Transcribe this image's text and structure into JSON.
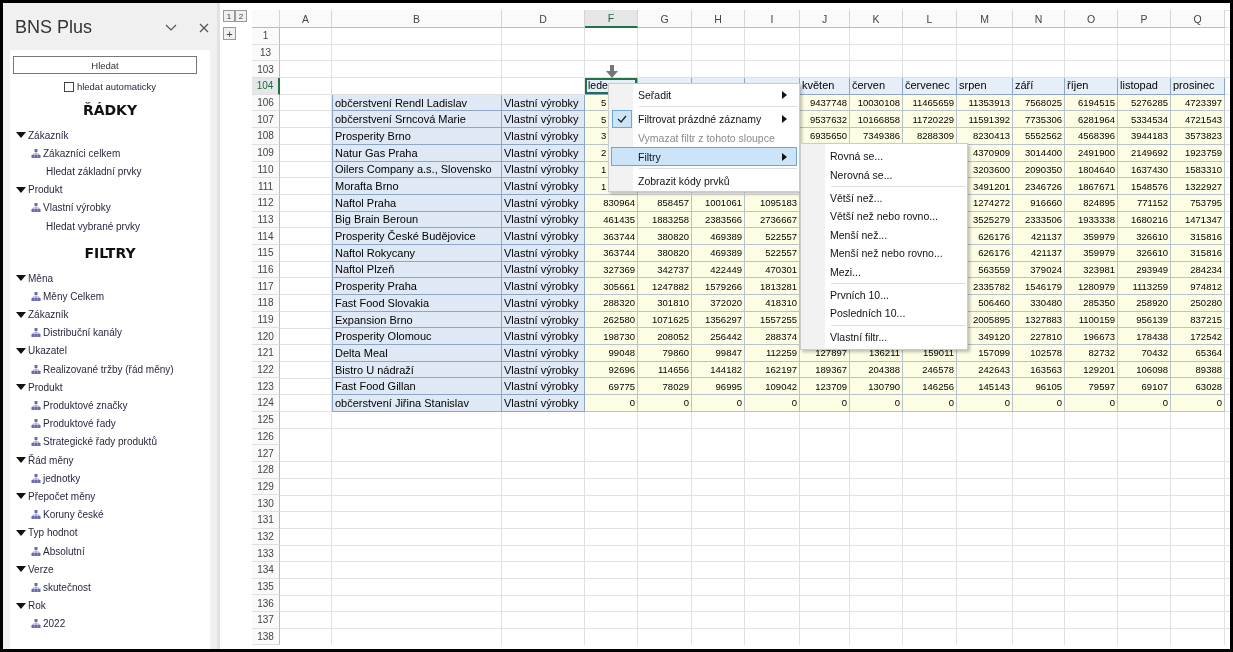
{
  "sidebar": {
    "title": "BNS Plus",
    "search_button": "Hledat",
    "auto_search": {
      "label": "hledat automaticky",
      "checked": false
    },
    "sections": [
      {
        "heading": "ŘÁDKY",
        "groups": [
          {
            "label": "Zákazník",
            "expanded": true,
            "children": [
              {
                "label": "Zákazníci celkem",
                "kind": "member"
              },
              {
                "label": "Hledat základní prvky",
                "kind": "link"
              }
            ]
          },
          {
            "label": "Produkt",
            "expanded": true,
            "children": [
              {
                "label": "Vlastní výrobky",
                "kind": "member"
              },
              {
                "label": "Hledat vybrané prvky",
                "kind": "link"
              }
            ]
          }
        ]
      },
      {
        "heading": "FILTRY",
        "groups": [
          {
            "label": "Měna",
            "expanded": true,
            "children": [
              {
                "label": "Měny Celkem",
                "kind": "member"
              }
            ]
          },
          {
            "label": "Zákazník",
            "expanded": true,
            "children": [
              {
                "label": "Distribuční kanály",
                "kind": "member"
              }
            ]
          },
          {
            "label": "Ukazatel",
            "expanded": true,
            "children": [
              {
                "label": "Realizované tržby (řád měny)",
                "kind": "member"
              }
            ]
          },
          {
            "label": "Produkt",
            "expanded": true,
            "children": [
              {
                "label": "Produktové značky",
                "kind": "member"
              },
              {
                "label": "Produktové řady",
                "kind": "member"
              },
              {
                "label": "Strategické řady produktů",
                "kind": "member"
              }
            ]
          },
          {
            "label": "Řád měny",
            "expanded": true,
            "children": [
              {
                "label": "jednotky",
                "kind": "member"
              }
            ]
          },
          {
            "label": "Přepočet měny",
            "expanded": true,
            "children": [
              {
                "label": "Koruny české",
                "kind": "member"
              }
            ]
          },
          {
            "label": "Typ hodnot",
            "expanded": true,
            "children": [
              {
                "label": "Absolutní",
                "kind": "member"
              }
            ]
          },
          {
            "label": "Verze",
            "expanded": true,
            "children": [
              {
                "label": "skutečnost",
                "kind": "member"
              }
            ]
          },
          {
            "label": "Rok",
            "expanded": true,
            "children": [
              {
                "label": "2022",
                "kind": "member"
              }
            ]
          }
        ]
      }
    ]
  },
  "sheet": {
    "outline": {
      "levels": [
        "1",
        "2"
      ],
      "expand": "+"
    },
    "columns": [
      {
        "label": "A",
        "selected": false
      },
      {
        "label": "B",
        "selected": false
      },
      {
        "label": "D",
        "selected": false
      },
      {
        "label": "F",
        "selected": true
      },
      {
        "label": "G",
        "selected": false
      },
      {
        "label": "H",
        "selected": false
      },
      {
        "label": "I",
        "selected": false
      },
      {
        "label": "J",
        "selected": false
      },
      {
        "label": "K",
        "selected": false
      },
      {
        "label": "L",
        "selected": false
      },
      {
        "label": "M",
        "selected": false
      },
      {
        "label": "N",
        "selected": false
      },
      {
        "label": "O",
        "selected": false
      },
      {
        "label": "P",
        "selected": false
      },
      {
        "label": "Q",
        "selected": false
      }
    ],
    "rows": [
      {
        "number": "1",
        "kind": "blank",
        "selected": false
      },
      {
        "number": "13",
        "kind": "blank",
        "selected": false
      },
      {
        "number": "103",
        "kind": "blank",
        "selected": false
      },
      {
        "number": "104",
        "kind": "header",
        "selected": true,
        "months": [
          {
            "kind": "label",
            "label": "lede",
            "selected": true
          },
          {
            "kind": "covered",
            "selected": false
          },
          {
            "kind": "covered",
            "selected": false
          },
          {
            "kind": "covered",
            "selected": false
          },
          {
            "kind": "label",
            "label": "květen",
            "selected": false
          },
          {
            "kind": "label",
            "label": "červen",
            "selected": false
          },
          {
            "kind": "label",
            "label": "červenec",
            "selected": false
          },
          {
            "kind": "label",
            "label": "srpen",
            "selected": false
          },
          {
            "kind": "label",
            "label": "září",
            "selected": false
          },
          {
            "kind": "label",
            "label": "říjen",
            "selected": false
          },
          {
            "kind": "label",
            "label": "listopad",
            "selected": false
          },
          {
            "kind": "label",
            "label": "prosinec",
            "selected": false
          }
        ]
      },
      {
        "number": "106",
        "kind": "data",
        "selected": false,
        "customer": "občerstvení Rendl Ladislav",
        "product": "Vlastní výrobky",
        "cells": [
          {
            "kind": "clipped",
            "value": "5"
          },
          {
            "kind": "covered"
          },
          {
            "kind": "covered"
          },
          {
            "kind": "covered"
          },
          {
            "kind": "number",
            "value": "9437748"
          },
          {
            "kind": "number",
            "value": "10030108"
          },
          {
            "kind": "number",
            "value": "11465659"
          },
          {
            "kind": "number",
            "value": "11353913"
          },
          {
            "kind": "number",
            "value": "7568025"
          },
          {
            "kind": "number",
            "value": "6194515"
          },
          {
            "kind": "number",
            "value": "5276285"
          },
          {
            "kind": "number",
            "value": "4723397"
          }
        ]
      },
      {
        "number": "107",
        "kind": "data",
        "selected": false,
        "customer": "občerstvení Srncová Marie",
        "product": "Vlastní výrobky",
        "cells": [
          {
            "kind": "clipped",
            "value": "5"
          },
          {
            "kind": "covered"
          },
          {
            "kind": "covered"
          },
          {
            "kind": "covered"
          },
          {
            "kind": "number",
            "value": "9537632"
          },
          {
            "kind": "number",
            "value": "10166858"
          },
          {
            "kind": "number",
            "value": "11720229"
          },
          {
            "kind": "number",
            "value": "11591392"
          },
          {
            "kind": "number",
            "value": "7735306"
          },
          {
            "kind": "number",
            "value": "6281964"
          },
          {
            "kind": "number",
            "value": "5334534"
          },
          {
            "kind": "number",
            "value": "4721543"
          }
        ]
      },
      {
        "number": "108",
        "kind": "data",
        "selected": false,
        "customer": "Prosperity Brno",
        "product": "Vlastní výrobky",
        "cells": [
          {
            "kind": "clipped",
            "value": "3"
          },
          {
            "kind": "covered"
          },
          {
            "kind": "covered"
          },
          {
            "kind": "covered"
          },
          {
            "kind": "number",
            "value": "6935650"
          },
          {
            "kind": "number",
            "value": "7349386"
          },
          {
            "kind": "number",
            "value": "8288309"
          },
          {
            "kind": "number",
            "value": "8230413"
          },
          {
            "kind": "number",
            "value": "5552562"
          },
          {
            "kind": "number",
            "value": "4568396"
          },
          {
            "kind": "number",
            "value": "3944183"
          },
          {
            "kind": "number",
            "value": "3573823"
          }
        ]
      },
      {
        "number": "109",
        "kind": "data",
        "selected": false,
        "customer": "Natur Gas Praha",
        "product": "Vlastní výrobky",
        "cells": [
          {
            "kind": "clipped",
            "value": "2"
          },
          {
            "kind": "covered"
          },
          {
            "kind": "covered"
          },
          {
            "kind": "covered"
          },
          {
            "kind": "covered"
          },
          {
            "kind": "covered"
          },
          {
            "kind": "covered"
          },
          {
            "kind": "number",
            "value": "4370909"
          },
          {
            "kind": "number",
            "value": "3014400"
          },
          {
            "kind": "number",
            "value": "2491900"
          },
          {
            "kind": "number",
            "value": "2149692"
          },
          {
            "kind": "number",
            "value": "1923759"
          }
        ]
      },
      {
        "number": "110",
        "kind": "data",
        "selected": false,
        "customer": "Oilers Company a.s., Slovensko",
        "product": "Vlastní výrobky",
        "cells": [
          {
            "kind": "clipped",
            "value": "1"
          },
          {
            "kind": "covered"
          },
          {
            "kind": "covered"
          },
          {
            "kind": "covered"
          },
          {
            "kind": "covered"
          },
          {
            "kind": "covered"
          },
          {
            "kind": "covered"
          },
          {
            "kind": "number",
            "value": "3203600"
          },
          {
            "kind": "number",
            "value": "2090350"
          },
          {
            "kind": "number",
            "value": "1804640"
          },
          {
            "kind": "number",
            "value": "1637430"
          },
          {
            "kind": "number",
            "value": "1583310"
          }
        ]
      },
      {
        "number": "111",
        "kind": "data",
        "selected": false,
        "customer": "Morafta Brno",
        "product": "Vlastní výrobky",
        "cells": [
          {
            "kind": "clipped",
            "value": "1"
          },
          {
            "kind": "covered"
          },
          {
            "kind": "covered"
          },
          {
            "kind": "covered"
          },
          {
            "kind": "covered"
          },
          {
            "kind": "covered"
          },
          {
            "kind": "covered"
          },
          {
            "kind": "number",
            "value": "3491201"
          },
          {
            "kind": "number",
            "value": "2346726"
          },
          {
            "kind": "number",
            "value": "1867671"
          },
          {
            "kind": "number",
            "value": "1548576"
          },
          {
            "kind": "number",
            "value": "1322927"
          }
        ]
      },
      {
        "number": "112",
        "kind": "data",
        "selected": false,
        "customer": "Naftol Praha",
        "product": "Vlastní výrobky",
        "cells": [
          {
            "kind": "number",
            "value": "830964"
          },
          {
            "kind": "number",
            "value": "858457"
          },
          {
            "kind": "number",
            "value": "1001061"
          },
          {
            "kind": "number",
            "value": "1095183"
          },
          {
            "kind": "covered"
          },
          {
            "kind": "covered"
          },
          {
            "kind": "covered"
          },
          {
            "kind": "number",
            "value": "1274272"
          },
          {
            "kind": "number",
            "value": "916660"
          },
          {
            "kind": "number",
            "value": "824895"
          },
          {
            "kind": "number",
            "value": "771152"
          },
          {
            "kind": "number",
            "value": "753795"
          }
        ]
      },
      {
        "number": "113",
        "kind": "data",
        "selected": false,
        "customer": "Big Brain Beroun",
        "product": "Vlastní výrobky",
        "cells": [
          {
            "kind": "number",
            "value": "461435"
          },
          {
            "kind": "number",
            "value": "1883258"
          },
          {
            "kind": "number",
            "value": "2383566"
          },
          {
            "kind": "number",
            "value": "2736667"
          },
          {
            "kind": "covered"
          },
          {
            "kind": "covered"
          },
          {
            "kind": "covered"
          },
          {
            "kind": "number",
            "value": "3525279"
          },
          {
            "kind": "number",
            "value": "2333506"
          },
          {
            "kind": "number",
            "value": "1933338"
          },
          {
            "kind": "number",
            "value": "1680216"
          },
          {
            "kind": "number",
            "value": "1471347"
          }
        ]
      },
      {
        "number": "114",
        "kind": "data",
        "selected": false,
        "customer": "Prosperity České Budějovice",
        "product": "Vlastní výrobky",
        "cells": [
          {
            "kind": "number",
            "value": "363744"
          },
          {
            "kind": "number",
            "value": "380820"
          },
          {
            "kind": "number",
            "value": "469389"
          },
          {
            "kind": "number",
            "value": "522557"
          },
          {
            "kind": "covered"
          },
          {
            "kind": "covered"
          },
          {
            "kind": "covered"
          },
          {
            "kind": "number",
            "value": "626176"
          },
          {
            "kind": "number",
            "value": "421137"
          },
          {
            "kind": "number",
            "value": "359979"
          },
          {
            "kind": "number",
            "value": "326610"
          },
          {
            "kind": "number",
            "value": "315816"
          }
        ]
      },
      {
        "number": "115",
        "kind": "data",
        "selected": false,
        "customer": "Naftol Rokycany",
        "product": "Vlastní výrobky",
        "cells": [
          {
            "kind": "number",
            "value": "363744"
          },
          {
            "kind": "number",
            "value": "380820"
          },
          {
            "kind": "number",
            "value": "469389"
          },
          {
            "kind": "number",
            "value": "522557"
          },
          {
            "kind": "covered"
          },
          {
            "kind": "covered"
          },
          {
            "kind": "covered"
          },
          {
            "kind": "number",
            "value": "626176"
          },
          {
            "kind": "number",
            "value": "421137"
          },
          {
            "kind": "number",
            "value": "359979"
          },
          {
            "kind": "number",
            "value": "326610"
          },
          {
            "kind": "number",
            "value": "315816"
          }
        ]
      },
      {
        "number": "116",
        "kind": "data",
        "selected": false,
        "customer": "Naftol Plzeň",
        "product": "Vlastní výrobky",
        "cells": [
          {
            "kind": "number",
            "value": "327369"
          },
          {
            "kind": "number",
            "value": "342737"
          },
          {
            "kind": "number",
            "value": "422449"
          },
          {
            "kind": "number",
            "value": "470301"
          },
          {
            "kind": "covered"
          },
          {
            "kind": "covered"
          },
          {
            "kind": "covered"
          },
          {
            "kind": "number",
            "value": "563559"
          },
          {
            "kind": "number",
            "value": "379024"
          },
          {
            "kind": "number",
            "value": "323981"
          },
          {
            "kind": "number",
            "value": "293949"
          },
          {
            "kind": "number",
            "value": "284234"
          }
        ]
      },
      {
        "number": "117",
        "kind": "data",
        "selected": false,
        "customer": "Prosperity Praha",
        "product": "Vlastní výrobky",
        "cells": [
          {
            "kind": "number",
            "value": "305661"
          },
          {
            "kind": "number",
            "value": "1247882"
          },
          {
            "kind": "number",
            "value": "1579266"
          },
          {
            "kind": "number",
            "value": "1813281"
          },
          {
            "kind": "covered"
          },
          {
            "kind": "covered"
          },
          {
            "kind": "covered"
          },
          {
            "kind": "number",
            "value": "2335782"
          },
          {
            "kind": "number",
            "value": "1546179"
          },
          {
            "kind": "number",
            "value": "1280979"
          },
          {
            "kind": "number",
            "value": "1113259"
          },
          {
            "kind": "number",
            "value": "974812"
          }
        ]
      },
      {
        "number": "118",
        "kind": "data",
        "selected": false,
        "customer": "Fast Food Slovakia",
        "product": "Vlastní výrobky",
        "cells": [
          {
            "kind": "number",
            "value": "288320"
          },
          {
            "kind": "number",
            "value": "301810"
          },
          {
            "kind": "number",
            "value": "372020"
          },
          {
            "kind": "number",
            "value": "418310"
          },
          {
            "kind": "covered"
          },
          {
            "kind": "covered"
          },
          {
            "kind": "covered"
          },
          {
            "kind": "number",
            "value": "506460"
          },
          {
            "kind": "number",
            "value": "330480"
          },
          {
            "kind": "number",
            "value": "285350"
          },
          {
            "kind": "number",
            "value": "258920"
          },
          {
            "kind": "number",
            "value": "250280"
          }
        ]
      },
      {
        "number": "119",
        "kind": "data",
        "selected": false,
        "customer": "Expansion Brno",
        "product": "Vlastní výrobky",
        "cells": [
          {
            "kind": "number",
            "value": "262580"
          },
          {
            "kind": "number",
            "value": "1071625"
          },
          {
            "kind": "number",
            "value": "1356297"
          },
          {
            "kind": "number",
            "value": "1557255"
          },
          {
            "kind": "covered"
          },
          {
            "kind": "covered"
          },
          {
            "kind": "covered"
          },
          {
            "kind": "number",
            "value": "2005895"
          },
          {
            "kind": "number",
            "value": "1327883"
          },
          {
            "kind": "number",
            "value": "1100159"
          },
          {
            "kind": "number",
            "value": "956139"
          },
          {
            "kind": "number",
            "value": "837215"
          }
        ]
      },
      {
        "number": "120",
        "kind": "data",
        "selected": false,
        "customer": "Prosperity Olomouc",
        "product": "Vlastní výrobky",
        "cells": [
          {
            "kind": "number",
            "value": "198730"
          },
          {
            "kind": "number",
            "value": "208052"
          },
          {
            "kind": "number",
            "value": "256442"
          },
          {
            "kind": "number",
            "value": "288374"
          },
          {
            "kind": "covered"
          },
          {
            "kind": "covered"
          },
          {
            "kind": "covered"
          },
          {
            "kind": "number",
            "value": "349120"
          },
          {
            "kind": "number",
            "value": "227810"
          },
          {
            "kind": "number",
            "value": "196673"
          },
          {
            "kind": "number",
            "value": "178438"
          },
          {
            "kind": "number",
            "value": "172542"
          }
        ]
      },
      {
        "number": "121",
        "kind": "data",
        "selected": false,
        "customer": "Delta Meal",
        "product": "Vlastní výrobky",
        "cells": [
          {
            "kind": "number",
            "value": "99048"
          },
          {
            "kind": "number",
            "value": "79860"
          },
          {
            "kind": "number",
            "value": "99847"
          },
          {
            "kind": "number",
            "value": "112259"
          },
          {
            "kind": "number",
            "value": "127897"
          },
          {
            "kind": "number",
            "value": "136211"
          },
          {
            "kind": "number",
            "value": "159011"
          },
          {
            "kind": "number",
            "value": "157099"
          },
          {
            "kind": "number",
            "value": "102578"
          },
          {
            "kind": "number",
            "value": "82732"
          },
          {
            "kind": "number",
            "value": "70432"
          },
          {
            "kind": "number",
            "value": "65364"
          }
        ]
      },
      {
        "number": "122",
        "kind": "data",
        "selected": false,
        "customer": "Bistro U nádraží",
        "product": "Vlastní výrobky",
        "cells": [
          {
            "kind": "number",
            "value": "92696"
          },
          {
            "kind": "number",
            "value": "114656"
          },
          {
            "kind": "number",
            "value": "144182"
          },
          {
            "kind": "number",
            "value": "162197"
          },
          {
            "kind": "number",
            "value": "189367"
          },
          {
            "kind": "number",
            "value": "204388"
          },
          {
            "kind": "number",
            "value": "246578"
          },
          {
            "kind": "number",
            "value": "242643"
          },
          {
            "kind": "number",
            "value": "163563"
          },
          {
            "kind": "number",
            "value": "129201"
          },
          {
            "kind": "number",
            "value": "106098"
          },
          {
            "kind": "number",
            "value": "89388"
          }
        ]
      },
      {
        "number": "123",
        "kind": "data",
        "selected": false,
        "customer": "Fast Food Gillan",
        "product": "Vlastní výrobky",
        "cells": [
          {
            "kind": "number",
            "value": "69775"
          },
          {
            "kind": "number",
            "value": "78029"
          },
          {
            "kind": "number",
            "value": "96995"
          },
          {
            "kind": "number",
            "value": "109042"
          },
          {
            "kind": "number",
            "value": "123709"
          },
          {
            "kind": "number",
            "value": "130790"
          },
          {
            "kind": "number",
            "value": "146256"
          },
          {
            "kind": "number",
            "value": "145143"
          },
          {
            "kind": "number",
            "value": "96105"
          },
          {
            "kind": "number",
            "value": "79597"
          },
          {
            "kind": "number",
            "value": "69107"
          },
          {
            "kind": "number",
            "value": "63028"
          }
        ]
      },
      {
        "number": "124",
        "kind": "data",
        "selected": false,
        "customer": "občerstvení Jiřina Stanislav",
        "product": "Vlastní výrobky",
        "cells": [
          {
            "kind": "number",
            "value": "0"
          },
          {
            "kind": "number",
            "value": "0"
          },
          {
            "kind": "number",
            "value": "0"
          },
          {
            "kind": "number",
            "value": "0"
          },
          {
            "kind": "number",
            "value": "0"
          },
          {
            "kind": "number",
            "value": "0"
          },
          {
            "kind": "number",
            "value": "0"
          },
          {
            "kind": "number",
            "value": "0"
          },
          {
            "kind": "number",
            "value": "0"
          },
          {
            "kind": "number",
            "value": "0"
          },
          {
            "kind": "number",
            "value": "0"
          },
          {
            "kind": "number",
            "value": "0"
          }
        ]
      },
      {
        "number": "125",
        "kind": "blank",
        "selected": false
      },
      {
        "number": "126",
        "kind": "blank",
        "selected": false
      },
      {
        "number": "127",
        "kind": "blank",
        "selected": false
      },
      {
        "number": "128",
        "kind": "blank",
        "selected": false
      },
      {
        "number": "129",
        "kind": "blank",
        "selected": false
      },
      {
        "number": "130",
        "kind": "blank",
        "selected": false
      },
      {
        "number": "131",
        "kind": "blank",
        "selected": false
      },
      {
        "number": "132",
        "kind": "blank",
        "selected": false
      },
      {
        "number": "133",
        "kind": "blank",
        "selected": false
      },
      {
        "number": "134",
        "kind": "blank",
        "selected": false
      },
      {
        "number": "135",
        "kind": "blank",
        "selected": false
      },
      {
        "number": "136",
        "kind": "blank",
        "selected": false
      },
      {
        "number": "137",
        "kind": "blank",
        "selected": false
      },
      {
        "number": "138",
        "kind": "blank",
        "selected": false
      }
    ]
  },
  "context_menu": {
    "items": [
      {
        "kind": "item",
        "label": "Seřadit",
        "checked": false,
        "disabled": false,
        "selected": false,
        "submenu": true
      },
      {
        "kind": "separator"
      },
      {
        "kind": "item",
        "label": "Filtrovat prázdné záznamy",
        "checked": true,
        "disabled": false,
        "selected": false,
        "submenu": true
      },
      {
        "kind": "item",
        "label": "Vymazat filtr z tohoto sloupce",
        "checked": false,
        "disabled": true,
        "selected": false,
        "submenu": false
      },
      {
        "kind": "item",
        "label": "Filtry",
        "checked": false,
        "disabled": false,
        "selected": true,
        "submenu": true
      },
      {
        "kind": "separator"
      },
      {
        "kind": "item",
        "label": "Zobrazit kódy prvků",
        "checked": false,
        "disabled": false,
        "selected": false,
        "submenu": false
      }
    ],
    "submenu": {
      "items": [
        {
          "kind": "item",
          "label": "Rovná se..."
        },
        {
          "kind": "item",
          "label": "Nerovná se..."
        },
        {
          "kind": "separator"
        },
        {
          "kind": "item",
          "label": "Větší než..."
        },
        {
          "kind": "item",
          "label": "Větší než nebo rovno..."
        },
        {
          "kind": "item",
          "label": "Menší než..."
        },
        {
          "kind": "item",
          "label": "Menší než nebo rovno..."
        },
        {
          "kind": "item",
          "label": "Mezi..."
        },
        {
          "kind": "separator"
        },
        {
          "kind": "item",
          "label": "Prvních 10..."
        },
        {
          "kind": "item",
          "label": "Posledních 10..."
        },
        {
          "kind": "separator"
        },
        {
          "kind": "item",
          "label": "Vlastní filtr..."
        }
      ]
    }
  }
}
